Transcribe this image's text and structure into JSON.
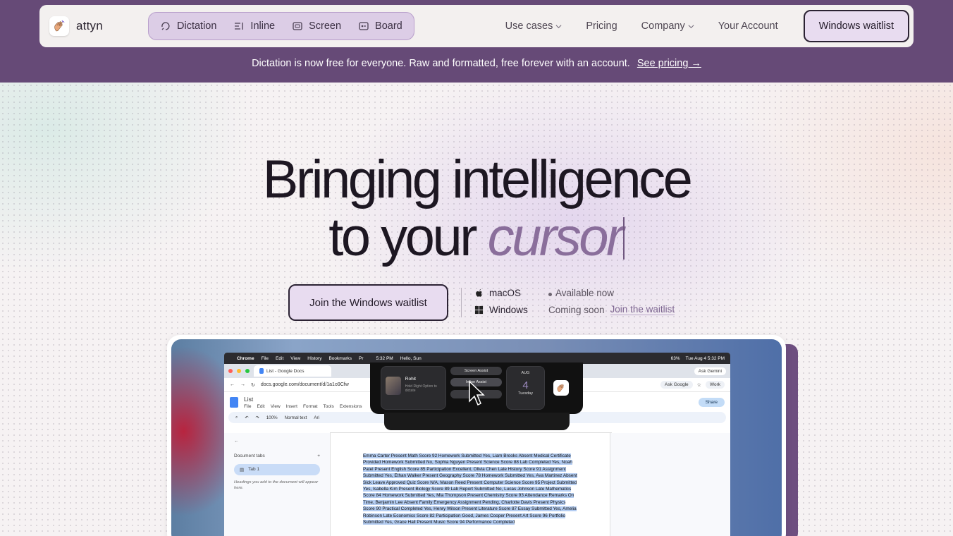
{
  "colors": {
    "brand_purple": "#664a77",
    "cta_fill": "#e8dcf0",
    "accent_italic": "#8a6e9b"
  },
  "nav": {
    "brand": "attyn",
    "modes": [
      {
        "label": "Dictation",
        "icon": "dictation-icon"
      },
      {
        "label": "Inline",
        "icon": "inline-icon"
      },
      {
        "label": "Screen",
        "icon": "screen-icon"
      },
      {
        "label": "Board",
        "icon": "board-icon"
      }
    ],
    "links": [
      {
        "label": "Use cases",
        "has_dropdown": true
      },
      {
        "label": "Pricing",
        "has_dropdown": false
      },
      {
        "label": "Company",
        "has_dropdown": true
      },
      {
        "label": "Your Account",
        "has_dropdown": false
      }
    ],
    "cta": "Windows waitlist"
  },
  "announcement": {
    "text": "Dictation is now free for everyone. Raw and formatted, free forever with an account.",
    "link": "See pricing →"
  },
  "hero": {
    "line1": "Bringing intelligence",
    "line2_plain": "to your ",
    "line2_italic": "cursor",
    "cta": "Join the Windows waitlist",
    "platforms": [
      {
        "name": "macOS",
        "status": "Available now"
      },
      {
        "name": "Windows",
        "status": "Coming soon",
        "link": "Join the waitlist"
      }
    ]
  },
  "screenshot": {
    "menubar": {
      "apple": "",
      "app": "Chrome",
      "menus": [
        "File",
        "Edit",
        "View",
        "History",
        "Bookmarks",
        "Pr"
      ],
      "time": "5:32 PM",
      "greeting": "Hello, Sun",
      "battery": "63%",
      "date": "Tue Aug 4  5:32 PM"
    },
    "tab_title": "List - Google Docs",
    "gemini": "Ask Gemini",
    "url": "docs.google.com/document/d/1a1o9Cfw",
    "ask_google": "Ask Google",
    "work": "Work",
    "doc_title": "List",
    "doc_menus": [
      "File",
      "Edit",
      "View",
      "Insert",
      "Format",
      "Tools",
      "Extensions"
    ],
    "share": "Share",
    "toolbar": {
      "zoom": "100%",
      "style": "Normal text",
      "font": "Ari"
    },
    "side": {
      "tabs_label": "Document tabs",
      "tab1": "Tab 1",
      "hint": "Headings you add to the document will appear here."
    },
    "body_text": "Emma Carter Present Math Score 92 Homework Submitted Yes, Liam Brooks Absent Medical Certificate Provided Homework Submitted No, Sophia Nguyen Present Science Score 88 Lab Completed Yes, Noah Patel Present English Score 85 Participation Excellent, Olivia Chen Late History Score 91 Assignment Submitted Yes, Ethan Walker Present Geography Score 78 Homework Submitted Yes, Ava Martinez Absent Sick Leave Approved Quiz Score N/A, Mason Reed Present Computer Science Score 95 Project Submitted Yes, Isabella Kim Present Biology Score 89 Lab Report Submitted No, Lucas Johnson Late Mathematics Score 84 Homework Submitted Yes, Mia Thompson Present Chemistry Score 93 Attendance Remarks On Time, Benjamin Lee Absent Family Emergency Assignment Pending, Charlotte Davis Present Physics Score 90 Practical Completed Yes, Henry Wilson Present Literature Score 87 Essay Submitted Yes, Amelia Robinson Late Economics Score 82 Participation Good, James Cooper Present Art Score 96 Portfolio Submitted Yes, Grace Hall Present Music Score 94 Performance Completed",
    "overlay": {
      "user_name": "Rohit",
      "user_hint": "Hold Right Option to dictate",
      "screen_assist": "Screen Assist",
      "inline_assist": "Inline Assist",
      "month": "AUG",
      "day": "4",
      "weekday": "Tuesday"
    }
  }
}
